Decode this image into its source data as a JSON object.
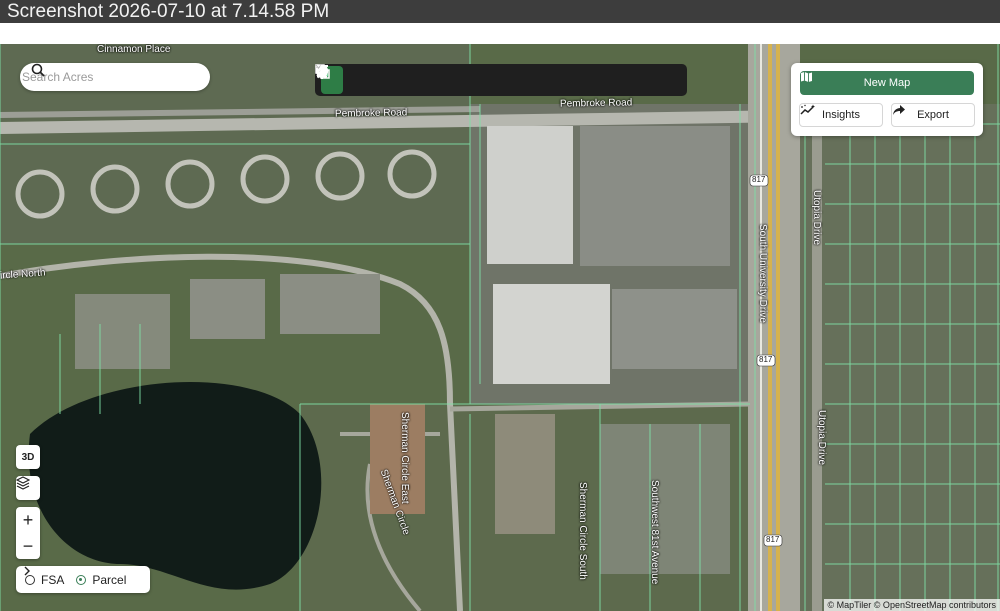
{
  "window": {
    "title": "Screenshot 2026-07-10 at 7.14.58  PM"
  },
  "search": {
    "placeholder": "Search Acres",
    "icon": "search-icon"
  },
  "toolbar": {
    "tools": [
      {
        "name": "select-tool",
        "icon": "cursor-icon",
        "active": true
      },
      {
        "name": "add-point-tool",
        "icon": "circle-plus-icon"
      },
      {
        "name": "person-tool",
        "icon": "person-icon"
      },
      {
        "name": "history-tool",
        "icon": "clock-icon"
      },
      {
        "name": "flag-tool",
        "icon": "flag-icon",
        "dropdown": true
      },
      {
        "name": "line-tool",
        "icon": "line-icon",
        "dropdown": true
      },
      {
        "name": "pin-tool",
        "icon": "pin-icon",
        "dropdown": true
      },
      {
        "name": "text-tool",
        "icon": "text-icon"
      },
      {
        "name": "shape-tool",
        "icon": "squares-icon",
        "dropdown": true
      },
      {
        "name": "measure-tool",
        "icon": "ruler-icon"
      },
      {
        "name": "survey-tool",
        "icon": "tripod-icon"
      },
      {
        "name": "upload-tool",
        "icon": "upload-icon"
      }
    ]
  },
  "panel": {
    "new_map_label": "New Map",
    "insights_label": "Insights",
    "export_label": "Export"
  },
  "controls": {
    "three_d_label": "3D",
    "zoom_in_label": "+",
    "zoom_out_label": "−",
    "layer_options": [
      {
        "label": "FSA",
        "selected": false
      },
      {
        "label": "Parcel",
        "selected": true
      }
    ]
  },
  "map": {
    "street_labels": {
      "cinnamon_place": "Cinnamon Place",
      "pembroke_road_1": "Pembroke Road",
      "pembroke_road_2": "Pembroke Road",
      "circle_north": "ircle North",
      "sherman_circle_east": "Sherman Circle East",
      "sherman_circle": "Sherman Circle",
      "sherman_circle_south": "Sherman Circle South",
      "southwest_81st_avenue": "Southwest 81st Avenue",
      "south_university_drive": "South University Drive",
      "utopia_drive_1": "Utopia Drive",
      "utopia_drive_2": "Utopia Drive",
      "shield_817_top": "817",
      "shield_817_mid": "817",
      "shield_817_bottom": "817"
    },
    "attribution": "© MapTiler © OpenStreetMap contributors"
  },
  "colors": {
    "accent": "#3a7e57",
    "parcel_line": "#7fe0a6",
    "toolbar_bg": "#1f1f1f"
  }
}
